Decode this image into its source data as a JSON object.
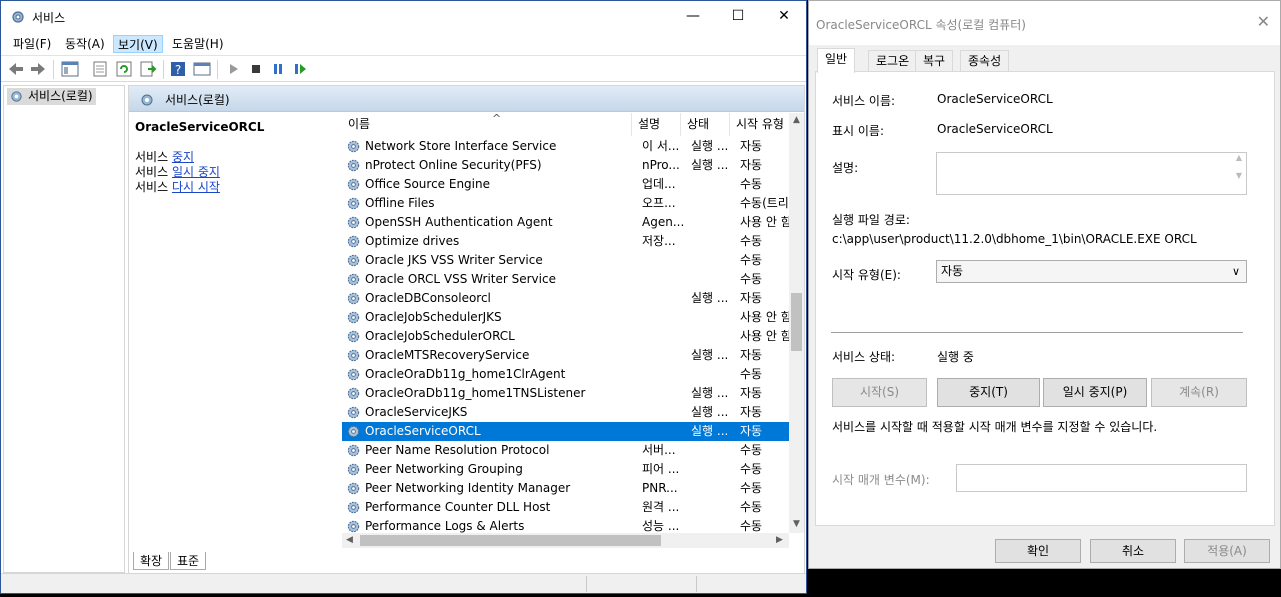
{
  "services_window": {
    "title": "서비스",
    "controls": {
      "minimize": "—",
      "maximize": "☐",
      "close": "✕"
    },
    "menu": [
      {
        "label": "파일(F)"
      },
      {
        "label": "동작(A)"
      },
      {
        "label": "보기(V)"
      },
      {
        "label": "도움말(H)"
      }
    ],
    "tree": {
      "node_label": "서비스(로컬)"
    },
    "pane_header": "서비스(로컬)",
    "details": {
      "service_name": "OracleServiceORCL",
      "actions": [
        {
          "prefix": "서비스 ",
          "link": "중지"
        },
        {
          "prefix": "서비스 ",
          "link": "일시 중지"
        },
        {
          "prefix": "서비스 ",
          "link": "다시 시작"
        }
      ]
    },
    "columns": {
      "name": "이름",
      "desc": "설명",
      "status": "상태",
      "startup": "시작 유형"
    },
    "rows": [
      {
        "name": "Network Store Interface Service",
        "desc": "이 서...",
        "status": "실행 ...",
        "startup": "자동"
      },
      {
        "name": "nProtect Online Security(PFS)",
        "desc": "nPro...",
        "status": "실행 ...",
        "startup": "자동"
      },
      {
        "name": "Office Source Engine",
        "desc": "업데...",
        "status": "",
        "startup": "수동"
      },
      {
        "name": "Offline Files",
        "desc": "오프...",
        "status": "",
        "startup": "수동(트리"
      },
      {
        "name": "OpenSSH Authentication Agent",
        "desc": "Agen...",
        "status": "",
        "startup": "사용 안 함"
      },
      {
        "name": "Optimize drives",
        "desc": "저장...",
        "status": "",
        "startup": "수동"
      },
      {
        "name": "Oracle JKS VSS Writer Service",
        "desc": "",
        "status": "",
        "startup": "수동"
      },
      {
        "name": "Oracle ORCL VSS Writer Service",
        "desc": "",
        "status": "",
        "startup": "수동"
      },
      {
        "name": "OracleDBConsoleorcl",
        "desc": "",
        "status": "실행 ...",
        "startup": "자동"
      },
      {
        "name": "OracleJobSchedulerJKS",
        "desc": "",
        "status": "",
        "startup": "사용 안 함"
      },
      {
        "name": "OracleJobSchedulerORCL",
        "desc": "",
        "status": "",
        "startup": "사용 안 함"
      },
      {
        "name": "OracleMTSRecoveryService",
        "desc": "",
        "status": "실행 ...",
        "startup": "자동"
      },
      {
        "name": "OracleOraDb11g_home1ClrAgent",
        "desc": "",
        "status": "",
        "startup": "수동"
      },
      {
        "name": "OracleOraDb11g_home1TNSListener",
        "desc": "",
        "status": "실행 ...",
        "startup": "자동"
      },
      {
        "name": "OracleServiceJKS",
        "desc": "",
        "status": "실행 ...",
        "startup": "자동"
      },
      {
        "name": "OracleServiceORCL",
        "desc": "",
        "status": "실행 ...",
        "startup": "자동",
        "selected": true
      },
      {
        "name": "Peer Name Resolution Protocol",
        "desc": "서버...",
        "status": "",
        "startup": "수동"
      },
      {
        "name": "Peer Networking Grouping",
        "desc": "피어 ...",
        "status": "",
        "startup": "수동"
      },
      {
        "name": "Peer Networking Identity Manager",
        "desc": "PNR...",
        "status": "",
        "startup": "수동"
      },
      {
        "name": "Performance Counter DLL Host",
        "desc": "원격 ...",
        "status": "",
        "startup": "수동"
      },
      {
        "name": "Performance Logs & Alerts",
        "desc": "성능 ...",
        "status": "",
        "startup": "수동"
      }
    ],
    "view_tabs": {
      "extended": "확장",
      "standard": "표준"
    }
  },
  "properties_dialog": {
    "title": "OracleServiceORCL 속성(로컬 컴퓨터)",
    "close": "✕",
    "tabs": [
      "일반",
      "로그온",
      "복구",
      "종속성"
    ],
    "service_name_label": "서비스 이름:",
    "service_name": "OracleServiceORCL",
    "display_name_label": "표시 이름:",
    "display_name": "OracleServiceORCL",
    "description_label": "설명:",
    "exe_path_label": "실행 파일 경로:",
    "exe_path": "c:\\app\\user\\product\\11.2.0\\dbhome_1\\bin\\ORACLE.EXE ORCL",
    "startup_type_label": "시작 유형(E):",
    "startup_type": "자동",
    "status_label": "서비스 상태:",
    "status_value": "실행 중",
    "buttons": {
      "start": "시작(S)",
      "stop": "중지(T)",
      "pause": "일시 중지(P)",
      "resume": "계속(R)"
    },
    "param_help": "서비스를 시작할 때 적용할 시작 매개 변수를 지정할 수 있습니다.",
    "param_label": "시작 매개 변수(M):",
    "param_value": "",
    "ok": "확인",
    "cancel": "취소",
    "apply": "적용(A)"
  }
}
